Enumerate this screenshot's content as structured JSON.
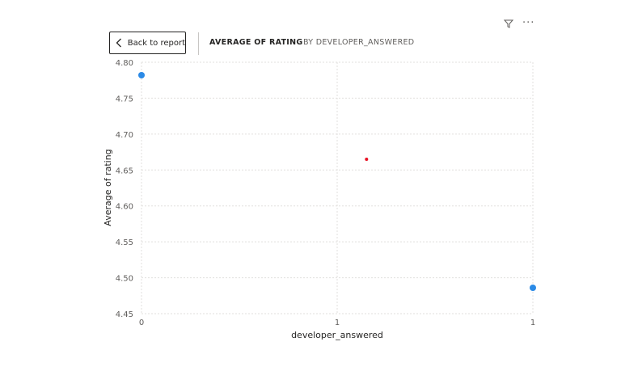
{
  "header": {
    "back_label": "Back to report",
    "title": "AVERAGE OF RATING",
    "subtitle": "BY DEVELOPER_ANSWERED"
  },
  "toolbar": {
    "filter_icon": "filter-icon",
    "more_icon": "more-options-icon",
    "more_glyph": "···"
  },
  "colors": {
    "series": "#2b8ae6",
    "highlight": "#e81123",
    "grid": "#e1dfdd"
  },
  "chart_data": {
    "type": "scatter",
    "xlabel": "developer_answered",
    "ylabel": "Average of rating",
    "xlim": [
      0,
      1
    ],
    "ylim": [
      4.45,
      4.8
    ],
    "x_ticks": [
      0,
      0.5,
      1
    ],
    "x_tick_labels": [
      "0",
      "1",
      "1"
    ],
    "y_ticks": [
      4.45,
      4.5,
      4.55,
      4.6,
      4.65,
      4.7,
      4.75,
      4.8
    ],
    "y_tick_labels": [
      "4.45",
      "4.50",
      "4.55",
      "4.60",
      "4.65",
      "4.70",
      "4.75",
      "4.80"
    ],
    "grid": true,
    "points": [
      {
        "x": 0,
        "y": 4.782
      },
      {
        "x": 1,
        "y": 4.486
      }
    ],
    "highlight_points": [
      {
        "x": 0.575,
        "y": 4.665
      }
    ]
  }
}
